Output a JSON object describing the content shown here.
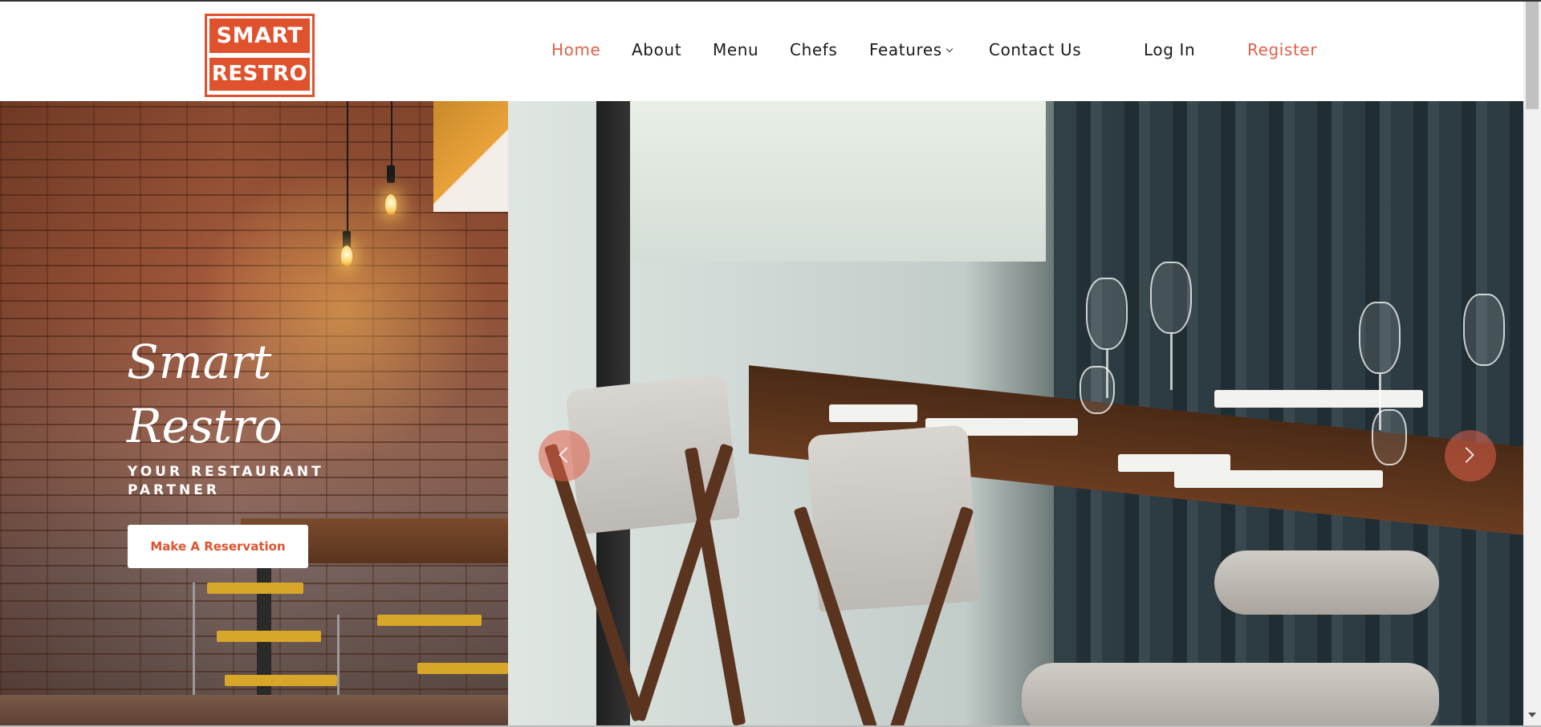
{
  "logo": {
    "line1": "SMART",
    "line2": "RESTRO"
  },
  "nav": {
    "items": [
      {
        "label": "Home",
        "active": true
      },
      {
        "label": "About"
      },
      {
        "label": "Menu"
      },
      {
        "label": "Chefs"
      },
      {
        "label": "Features",
        "has_dropdown": true
      },
      {
        "label": "Contact Us"
      }
    ],
    "login_label": "Log In",
    "register_label": "Register"
  },
  "hero": {
    "title_line1": "Smart",
    "title_line2": "Restro",
    "subtitle": "YOUR RESTAURANT PARTNER",
    "cta_label": "Make A Reservation"
  },
  "colors": {
    "accent": "#e0522e",
    "active_nav": "#e0604a",
    "text": "#1a1a1a",
    "arrow_bg": "rgba(224,96,74,0.55)"
  },
  "icons": {
    "prev": "chevron-left-icon",
    "next": "chevron-right-icon",
    "dropdown": "chevron-down-icon"
  }
}
